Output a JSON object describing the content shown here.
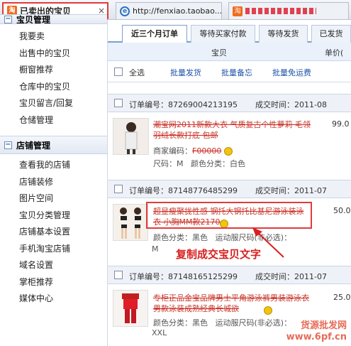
{
  "browser": {
    "tab_active": {
      "icon": "taobao-icon",
      "title": "已卖出的宝贝",
      "close": "×"
    },
    "tab_2": {
      "title": "http://fenxiao.taobao...."
    },
    "tab_3": {
      "title": "..."
    }
  },
  "sidebar": {
    "section_partial": "宝贝管理",
    "items_top": [
      "我要卖",
      "出售中的宝贝",
      "橱窗推荐",
      "仓库中的宝贝",
      "宝贝留言/回复",
      "仓储管理"
    ],
    "section_shop": "店铺管理",
    "items_shop": [
      "查看我的店铺",
      "店铺装修",
      "图片空间",
      "宝贝分类管理",
      "店铺基本设置",
      "手机淘宝店铺",
      "域名设置",
      "掌柜推荐",
      "媒体中心"
    ]
  },
  "main": {
    "tabs": [
      "近三个月订单",
      "等待买家付款",
      "等待发货",
      "已发货"
    ],
    "columns": {
      "item": "宝贝",
      "price": "单价("
    },
    "toolbar": {
      "select_all": "全选",
      "batch_ship": "批量发货",
      "batch_note": "批量备忘",
      "batch_free_ship": "批量免运费"
    },
    "orders": [
      {
        "order_no_label": "订单编号：87269004213195",
        "time_label": "成交时间：2011-08",
        "title": "潮宝网2011新款大衣 气质复古个性萝莉 毛领羽绒长款打底 包邮",
        "merchant": "商家编码：",
        "merchant_code": "F00000",
        "size": "尺码：M",
        "color": "颜色分类：白色",
        "price": "99.0"
      },
      {
        "order_no_label": "订单编号：87148776485299",
        "time_label": "成交时间：2011-07",
        "title": "超显瘦聚拢性感 钢托大钢托比基尼游泳装泳衣 小胸MM款2170",
        "color": "颜色分类：黑色",
        "style": "运动服尺码(非必选)：",
        "size": "M",
        "price": "50.0"
      },
      {
        "order_no_label": "订单编号：87148165125299",
        "time_label": "成交时间：2011-07",
        "title": "专柜正品金宝品牌男士平角游泳裤男装游泳衣男款泳装成熟经典长城欲",
        "size": "XXL",
        "color": "颜色分类：黑色",
        "style": "运动服尺码(非必选)：",
        "price": "25.0"
      }
    ]
  },
  "annotation": "复制成交宝贝文字",
  "watermark": {
    "line1": "货源批发网",
    "line2": "www.6pf.cn"
  }
}
